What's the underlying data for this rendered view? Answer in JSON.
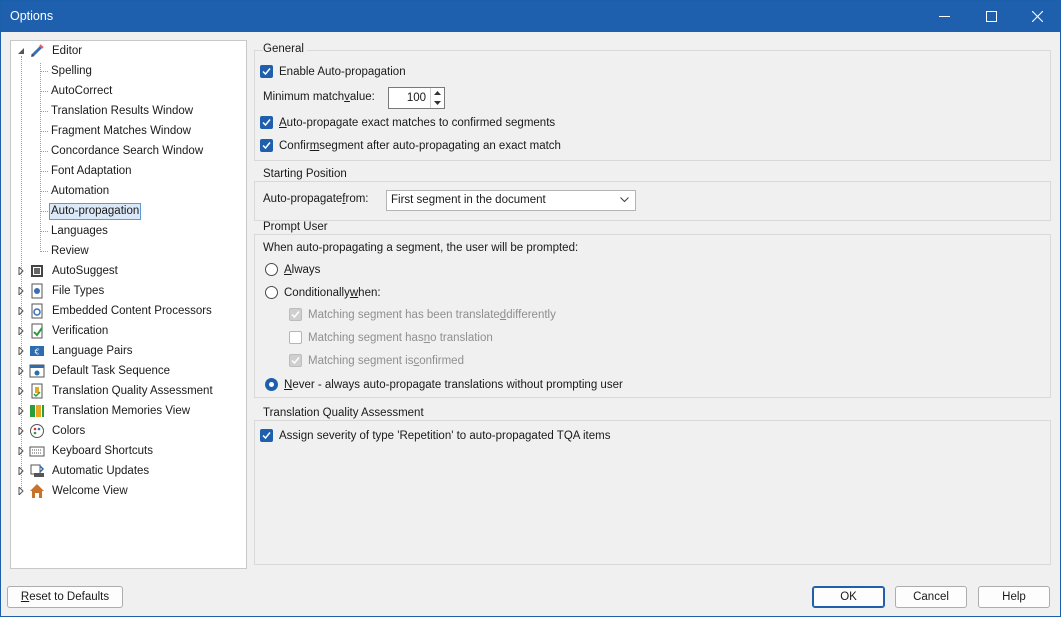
{
  "window": {
    "title": "Options"
  },
  "tree": {
    "root": {
      "label": "Editor",
      "icon": "pencil-icon"
    },
    "editor_children": [
      {
        "label": "Spelling"
      },
      {
        "label": "AutoCorrect"
      },
      {
        "label": "Translation Results Window"
      },
      {
        "label": "Fragment Matches Window"
      },
      {
        "label": "Concordance Search Window"
      },
      {
        "label": "Font Adaptation"
      },
      {
        "label": "Automation"
      },
      {
        "label": "Auto-propagation",
        "selected": true
      },
      {
        "label": "Languages"
      },
      {
        "label": "Review"
      }
    ],
    "top_level": [
      {
        "label": "AutoSuggest",
        "icon": "autosuggest-icon"
      },
      {
        "label": "File Types",
        "icon": "file-types-icon"
      },
      {
        "label": "Embedded Content Processors",
        "icon": "embedded-content-icon"
      },
      {
        "label": "Verification",
        "icon": "verification-icon"
      },
      {
        "label": "Language Pairs",
        "icon": "language-pairs-icon"
      },
      {
        "label": "Default Task Sequence",
        "icon": "task-sequence-icon"
      },
      {
        "label": "Translation Quality Assessment",
        "icon": "tqa-icon"
      },
      {
        "label": "Translation Memories View",
        "icon": "translation-memories-icon"
      },
      {
        "label": "Colors",
        "icon": "palette-icon"
      },
      {
        "label": "Keyboard Shortcuts",
        "icon": "keyboard-icon"
      },
      {
        "label": "Automatic Updates",
        "icon": "updates-icon"
      },
      {
        "label": "Welcome View",
        "icon": "home-icon"
      }
    ]
  },
  "general": {
    "title": "General",
    "enable": {
      "label": "Enable Auto-propagation",
      "checked": true
    },
    "min_match": {
      "label_pre": "Minimum match ",
      "label_u": "v",
      "label_post": "alue:",
      "value": "100"
    },
    "exact": {
      "label_u": "A",
      "label_post": "uto-propagate exact matches to confirmed segments",
      "checked": true
    },
    "confirm": {
      "label_pre": "Confir",
      "label_u": "m",
      "label_post": " segment after auto-propagating an exact match",
      "checked": true
    }
  },
  "starting": {
    "title": "Starting Position",
    "from": {
      "label_pre": "Auto-propagate ",
      "label_u": "f",
      "label_post": "rom:",
      "value": "First segment in the document"
    }
  },
  "prompt": {
    "title": "Prompt User",
    "description": "When auto-propagating a segment, the user will be prompted:",
    "always": {
      "label_pre": "",
      "label_u": "A",
      "label_post": "lways",
      "selected": false
    },
    "conditionally": {
      "label_pre": "Conditionally ",
      "label_u": "w",
      "label_post": "hen:",
      "selected": false
    },
    "cond_diff": {
      "label_pre": "Matching segment has been translate",
      "label_u": "d",
      "label_post": " differently",
      "checked": true
    },
    "cond_none": {
      "label_pre": "Matching segment has ",
      "label_u": "n",
      "label_post": "o translation",
      "checked": false
    },
    "cond_confirmed": {
      "label_pre": "Matching segment is ",
      "label_u": "c",
      "label_post": "onfirmed",
      "checked": true
    },
    "never": {
      "label_pre": "",
      "label_u": "N",
      "label_post": "ever - always auto-propagate translations without prompting user",
      "selected": true
    }
  },
  "tqa": {
    "title": "Translation Quality Assessment",
    "assign": {
      "label": "Assign severity of type 'Repetition' to auto-propagated TQA items",
      "checked": true
    }
  },
  "buttons": {
    "reset": {
      "label_pre": "",
      "label_u": "R",
      "label_post": "eset to Defaults"
    },
    "ok": "OK",
    "cancel": "Cancel",
    "help": "Help"
  },
  "colors": {
    "accent": "#1e5fae",
    "titlebar": "#1e5fae",
    "selection": "#dbe8f7"
  }
}
